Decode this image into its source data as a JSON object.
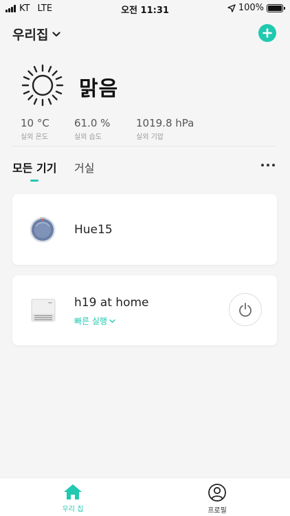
{
  "status_bar": {
    "carrier": "KT",
    "network": "LTE",
    "time": "오전 11:31",
    "battery": "100%",
    "battery_level": 1.0
  },
  "header": {
    "home_name": "우리집",
    "add_icon": "plus-circle-icon"
  },
  "weather": {
    "icon": "sun-icon",
    "condition": "맑음",
    "stats": [
      {
        "value": "10 °C",
        "label": "실외 온도"
      },
      {
        "value": "61.0 %",
        "label": "실외 습도"
      },
      {
        "value": "1019.8 hPa",
        "label": "실외 기압"
      }
    ]
  },
  "tabs": [
    {
      "label": "모든 기기",
      "active": true
    },
    {
      "label": "거실",
      "active": false
    }
  ],
  "devices": [
    {
      "name": "Hue15",
      "icon": "robot-vacuum-icon"
    },
    {
      "name": "h19 at home",
      "icon": "air-purifier-icon",
      "action_label": "빠른 실행",
      "power_icon": "power-icon"
    }
  ],
  "bottom_nav": [
    {
      "label": "우리 집",
      "icon": "home-icon",
      "active": true
    },
    {
      "label": "프로필",
      "icon": "profile-icon",
      "active": false
    }
  ],
  "colors": {
    "accent": "#20c9b0",
    "background": "#f5f5f5",
    "card": "#ffffff"
  }
}
